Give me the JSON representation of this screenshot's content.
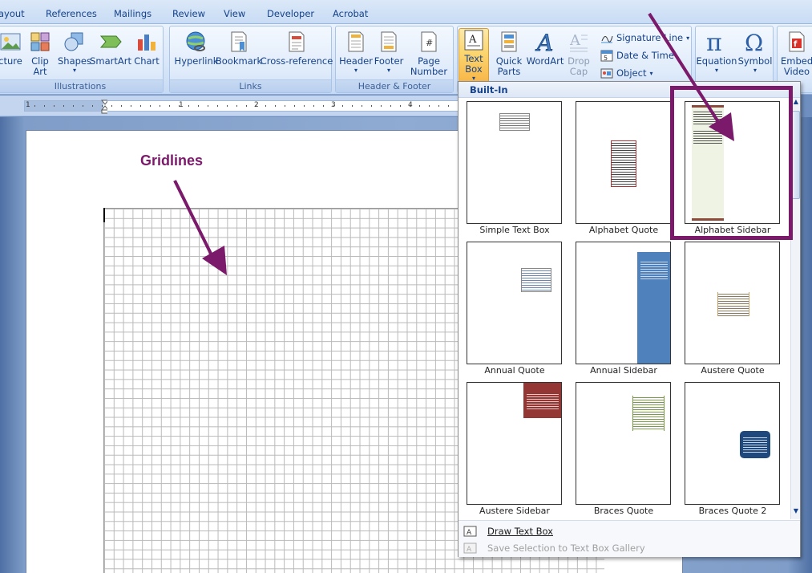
{
  "tabs": [
    "ayout",
    "References",
    "Mailings",
    "Review",
    "View",
    "Developer",
    "Acrobat"
  ],
  "groups": {
    "illustrations": {
      "label": "Illustrations",
      "buttons": [
        "cture",
        "Clip Art",
        "Shapes",
        "SmartArt",
        "Chart"
      ]
    },
    "links": {
      "label": "Links",
      "buttons": [
        "Hyperlink",
        "Bookmark",
        "Cross-reference"
      ]
    },
    "header_footer": {
      "label": "Header & Footer",
      "buttons": [
        "Header",
        "Footer",
        "Page Number"
      ]
    },
    "text": {
      "buttons": [
        "Text Box",
        "Quick Parts",
        "WordArt",
        "Drop Cap"
      ],
      "small": [
        "Signature Line",
        "Date & Time",
        "Object"
      ]
    },
    "symbols": {
      "buttons": [
        "Equation",
        "Symbol"
      ]
    },
    "flash": {
      "buttons": [
        "Embed Video"
      ]
    }
  },
  "ruler_numbers": [
    "1",
    "1",
    "2",
    "3",
    "4"
  ],
  "annotation": "Gridlines",
  "gallery": {
    "header": "Built-In",
    "items": [
      {
        "name": "Simple Text Box"
      },
      {
        "name": "Alphabet Quote"
      },
      {
        "name": "Alphabet Sidebar"
      },
      {
        "name": "Annual Quote"
      },
      {
        "name": "Annual Sidebar"
      },
      {
        "name": "Austere Quote"
      },
      {
        "name": "Austere Sidebar"
      },
      {
        "name": "Braces Quote"
      },
      {
        "name": "Braces Quote 2"
      }
    ],
    "footer": {
      "draw": "Draw Text Box",
      "save": "Save Selection to Text Box Gallery"
    }
  },
  "colors": {
    "annotation": "#7b1a6a",
    "ribbon_active": "#fbd670",
    "gallery_blue": "#4f81bd",
    "gallery_red": "#943634"
  }
}
